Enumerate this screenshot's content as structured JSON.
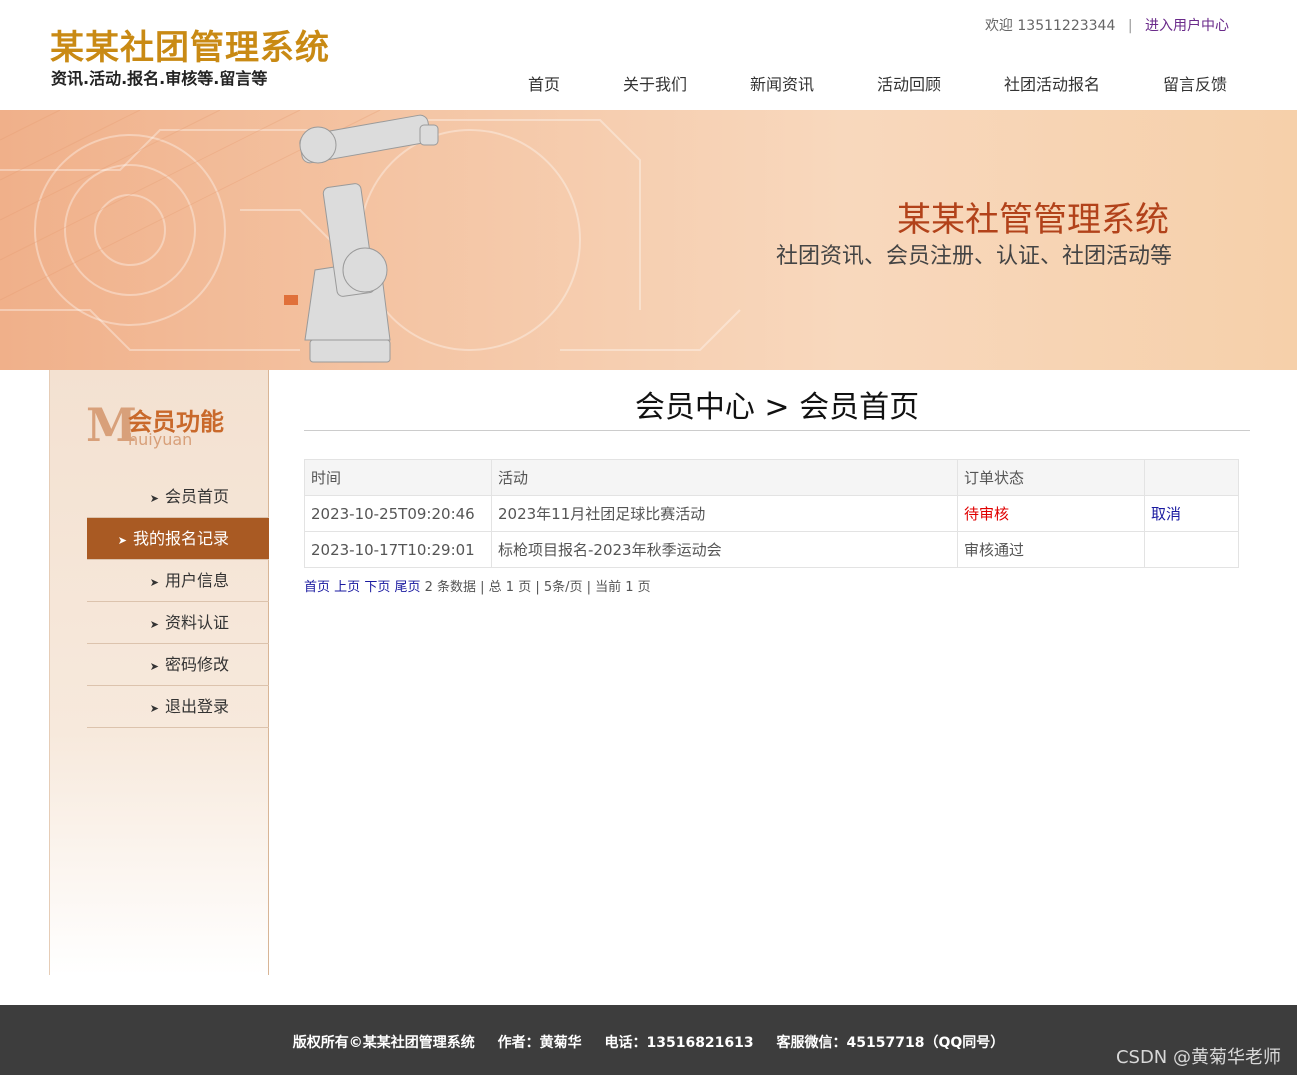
{
  "header": {
    "logo_title": "某某社团管理系统",
    "logo_subtitle": "资讯.活动.报名.审核等.留言等",
    "welcome_text": "欢迎 13511223344",
    "separator": "|",
    "user_center_link": "进入用户中心"
  },
  "nav": [
    {
      "label": "首页"
    },
    {
      "label": "关于我们"
    },
    {
      "label": "新闻资讯"
    },
    {
      "label": "活动回顾"
    },
    {
      "label": "社团活动报名"
    },
    {
      "label": "留言反馈"
    }
  ],
  "banner": {
    "title": "某某社管管理系统",
    "subtitle": "社团资讯、会员注册、认证、社团活动等"
  },
  "sidebar": {
    "heading_letter": "M",
    "heading_cn": "会员功能",
    "heading_en": "huiyuan",
    "items": [
      {
        "label": "会员首页",
        "active": false
      },
      {
        "label": "我的报名记录",
        "active": true
      },
      {
        "label": "用户信息",
        "active": false
      },
      {
        "label": "资料认证",
        "active": false
      },
      {
        "label": "密码修改",
        "active": false
      },
      {
        "label": "退出登录",
        "active": false
      }
    ]
  },
  "main": {
    "title": "会员中心 > 会员首页",
    "table": {
      "headers": [
        "时间",
        "活动",
        "订单状态",
        ""
      ],
      "rows": [
        {
          "time": "2023-10-25T09:20:46",
          "activity": "2023年11月社团足球比赛活动",
          "status": "待审核",
          "action": "取消"
        },
        {
          "time": "2023-10-17T10:29:01",
          "activity": "标枪项目报名-2023年秋季运动会",
          "status": "审核通过",
          "action": ""
        }
      ]
    },
    "pager": {
      "first": "首页",
      "prev": "上页",
      "next": "下页",
      "last": "尾页",
      "summary": "2 条数据 | 总 1 页 | 5条/页 | 当前 1 页"
    }
  },
  "footer": {
    "copyright": "版权所有©某某社团管理系统",
    "author": "作者：黄菊华",
    "phone": "电话：13516821613",
    "wechat": "客服微信：45157718（QQ同号）",
    "watermark": "CSDN @黄菊华老师"
  },
  "colors": {
    "logo": "#c98a14",
    "banner_title": "#b2421a",
    "sidebar_active": "#a95a23",
    "pending_status": "#e00000",
    "link": "#1a1aa0",
    "footer_bg": "#3d3d3d"
  }
}
